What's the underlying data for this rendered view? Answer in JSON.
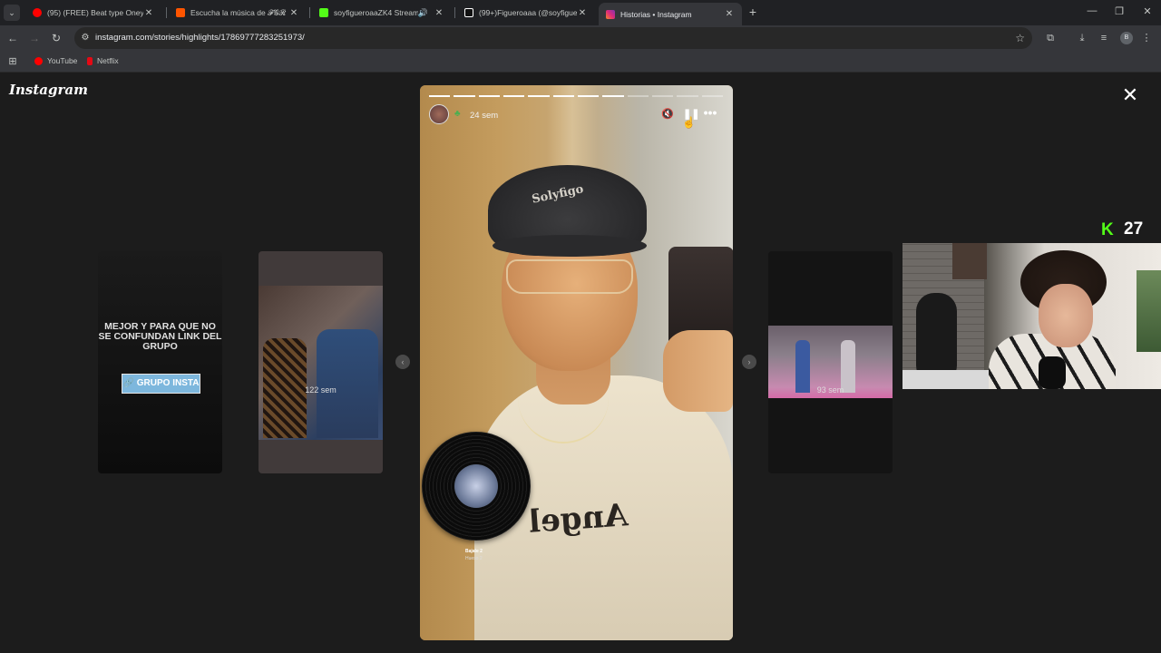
{
  "tabs": [
    {
      "title": "(95) (FREE) Beat type Oney1 \"V...",
      "icon": "youtube-icon",
      "color": "#ff0000",
      "active": false
    },
    {
      "title": "Escucha la música de 𝓕𝓖𝓡 𝓒𝓡...",
      "icon": "soundcloud-icon",
      "color": "#ff5500",
      "active": false
    },
    {
      "title": "soyfigueroaaZK4 Stream - ...",
      "icon": "kick-icon",
      "color": "#53fc18",
      "active": false,
      "audio": "🔊"
    },
    {
      "title": "(99+)Figueroaaa (@soyfigueroa...",
      "icon": "tiktok-icon",
      "color": "#ffffff",
      "active": false
    },
    {
      "title": "Historias • Instagram",
      "icon": "instagram-icon",
      "color": "#e1306c",
      "active": true
    }
  ],
  "toolbar": {
    "url": "instagram.com/stories/highlights/17869777283251973/",
    "profile_initial": "B"
  },
  "bookmarks": [
    {
      "label": "YouTube",
      "color": "#ff0000"
    },
    {
      "label": "Netflix",
      "color": "#e50914"
    }
  ],
  "page": {
    "logo": "Instagram",
    "close_glyph": "✕"
  },
  "side_stories": {
    "left_far": {
      "text": "MEJOR Y PARA QUE NO SE CONFUNDAN LINK DEL GRUPO",
      "button": "🔗 GRUPO INSTA"
    },
    "left_near": {
      "age": "122 sem"
    },
    "right": {
      "age": "93 sem"
    }
  },
  "story": {
    "age": "24 sem",
    "segments_total": 12,
    "segments_done": 8,
    "current_progress": 0.0,
    "cap_text": "Solyfigo",
    "shirt_text": "Angel",
    "music_title": "Bajale 2",
    "music_artist": "Hueso 2"
  },
  "stream_overlay": {
    "logo": "K",
    "count": "27"
  },
  "colors": {
    "background": "#1c1c1c",
    "kick_green": "#53fc18"
  }
}
